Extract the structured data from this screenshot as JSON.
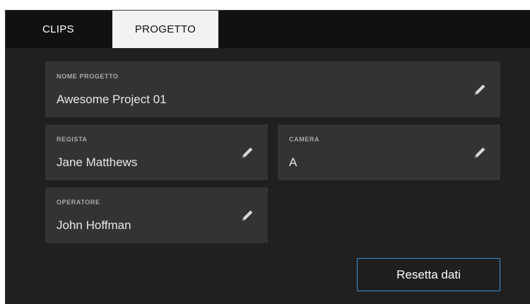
{
  "tabs": [
    {
      "label": "CLIPS",
      "active": false
    },
    {
      "label": "PROGETTO",
      "active": true
    }
  ],
  "fields": {
    "project_name": {
      "label": "NOME PROGETTO",
      "value": "Awesome Project 01"
    },
    "director": {
      "label": "REGISTA",
      "value": "Jane Matthews"
    },
    "camera": {
      "label": "CAMERA",
      "value": "A"
    },
    "operator": {
      "label": "OPERATORE",
      "value": "John Hoffman"
    }
  },
  "actions": {
    "reset_label": "Resetta dati"
  },
  "icons": {
    "edit": "pencil-icon"
  },
  "colors": {
    "background": "#202020",
    "tabbar": "#111111",
    "active_tab": "#f2f2f2",
    "card": "#333333",
    "accent": "#3b8fd8"
  }
}
